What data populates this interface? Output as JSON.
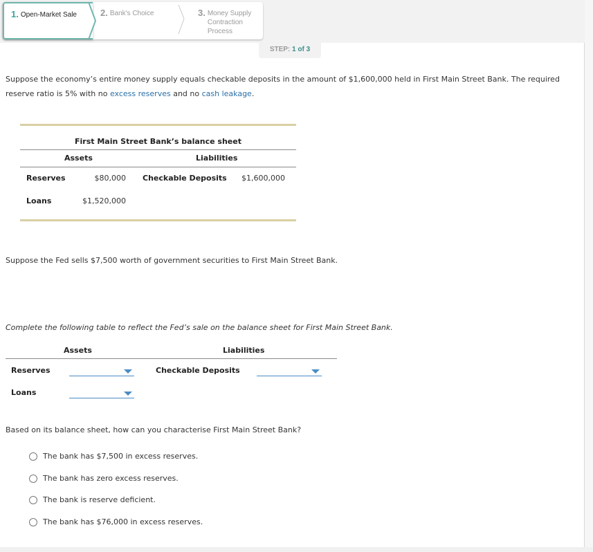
{
  "steps": {
    "tabs": [
      {
        "number": "1.",
        "label": "Open-Market Sale",
        "active": true
      },
      {
        "number": "2.",
        "label": "Bank's Choice",
        "active": false
      },
      {
        "number": "3.",
        "label": "Money Supply Contraction Process",
        "active": false
      }
    ],
    "counter": {
      "prefix": "STEP:",
      "current": "1 of 3"
    }
  },
  "intro": {
    "part1": "Suppose the economy’s entire money supply equals checkable deposits in the amount of $1,600,000 held in First Main Street Bank. The required reserve ratio is 5% with no ",
    "link1": "excess reserves",
    "part2": " and no ",
    "link2": "cash leakage",
    "part3": "."
  },
  "balance_sheet": {
    "title": "First Main Street Bank’s balance sheet",
    "assets_header": "Assets",
    "liabilities_header": "Liabilities",
    "rows": [
      {
        "asset_label": "Reserves",
        "asset_value": "$80,000",
        "liability_label": "Checkable Deposits",
        "liability_value": "$1,600,000"
      },
      {
        "asset_label": "Loans",
        "asset_value": "$1,520,000",
        "liability_label": "",
        "liability_value": ""
      }
    ]
  },
  "fed_sale_text": "Suppose the Fed sells $7,500 worth of government securities to First Main Street Bank.",
  "instruction": "Complete the following table to reflect the Fed’s sale on the balance sheet for First Main Street Bank.",
  "answer_table": {
    "assets_header": "Assets",
    "liabilities_header": "Liabilities",
    "reserves_label": "Reserves",
    "loans_label": "Loans",
    "deposits_label": "Checkable Deposits",
    "reserves_value": "",
    "loans_value": "",
    "deposits_value": ""
  },
  "question": "Based on its balance sheet, how can you characterise First Main Street Bank?",
  "options": [
    "The bank has $7,500 in excess reserves.",
    "The bank has zero excess reserves.",
    "The bank is reserve deficient.",
    "The bank has $76,000 in excess reserves."
  ],
  "colors": {
    "accent_teal": "#3aa59a",
    "link_blue": "#2a6fa8",
    "dropdown_blue": "#4a8cc4",
    "rule_gold": "#d9cfa3"
  }
}
